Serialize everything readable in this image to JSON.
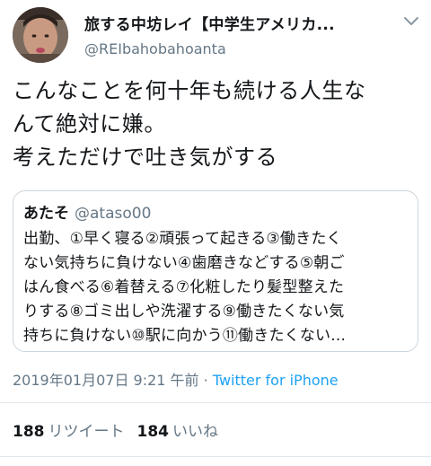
{
  "author": {
    "display_name": "旅する中坊レイ【中学生アメリカ...",
    "handle": "@REIbahobahoanta",
    "avatar_icon": "user-photo-avatar"
  },
  "tweet": {
    "lines": [
      "こんなことを何十年も続ける人生な",
      "んて絶対に嫌。",
      "考えただけで吐き気がする"
    ]
  },
  "quoted_tweet": {
    "name": "あたそ",
    "handle": "@ataso00",
    "lines": [
      "出勤、①早く寝る②頑張って起きる③働きたく",
      "ない気持ちに負けない④歯磨きなどする⑤朝ご",
      "はん食べる⑥着替える⑦化粧したり髪型整えた",
      "りする⑧ゴミ出しや洗濯する⑨働きたくない気",
      "持ちに負けない⑩駅に向かう⑪働きたくない..."
    ]
  },
  "meta": {
    "timestamp": "2019年01月07日 9:21 午前",
    "separator": " · ",
    "source": "Twitter for iPhone"
  },
  "stats": {
    "retweets_count": "188",
    "retweets_label": "リツイート",
    "likes_count": "184",
    "likes_label": "いいね"
  },
  "colors": {
    "link": "#1da1f2",
    "secondary_text": "#657786",
    "border": "#ccd6dd"
  }
}
